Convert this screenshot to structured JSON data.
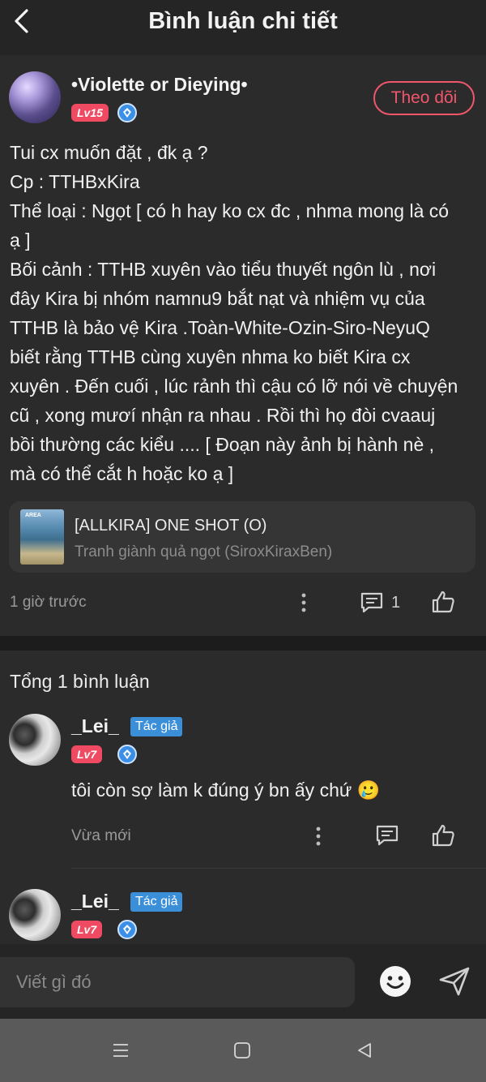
{
  "header": {
    "title": "Bình luận chi tiết"
  },
  "post": {
    "author_name": "•Violette or Dieying•",
    "author_level": "Lv15",
    "follow_label": "Theo dõi",
    "lines": [
      "Tui cx muốn đặt , đk ạ ?",
      "Cp : TTHBxKira",
      "Thể loại : Ngọt [ có h hay ko cx đc , nhma mong là có",
      "ạ ]",
      "Bối cảnh : TTHB xuyên vào tiểu thuyết ngôn lù , nơi",
      "đây Kira bị nhóm namnu9 bắt nạt và nhiệm vụ của",
      "TTHB là bảo vệ Kira .Toàn-White-Ozin-Siro-NeyuQ",
      "biết rằng TTHB cùng xuyên nhma ko biết Kira cx",
      "xuyên . Đến cuối , lúc rảnh thì cậu có lỡ nói về chuyện",
      "cũ , xong mươí nhận ra nhau . Rồi thì họ đòi cvaauj",
      "bồi thường các kiểu .... [ Đoạn này ảnh bị hành nè ,",
      "mà có thể cắt h hoặc ko ạ ]"
    ],
    "story": {
      "cover_text": "AREA",
      "title": "[ALLKIRA] ONE SHOT (O)",
      "subtitle": "Tranh giành quả ngọt (SiroxKiraxBen)"
    },
    "time": "1 giờ trước",
    "comment_count": "1"
  },
  "comments": {
    "total_label": "Tổng 1 bình luận",
    "items": [
      {
        "name": "_Lei_",
        "tag": "Tác giả",
        "level": "Lv7",
        "text": "tôi còn sợ làm k đúng ý bn ấy chứ 🥲",
        "time": "Vừa mới"
      },
      {
        "name": "_Lei_",
        "tag": "Tác giả",
        "level": "Lv7"
      }
    ]
  },
  "input": {
    "placeholder": "Viết gì đó"
  },
  "icons": {
    "back": "chevron-left-icon",
    "more": "more-vertical-icon",
    "comment": "comment-icon",
    "like": "thumbs-up-icon",
    "emoji": "smiley-icon",
    "send": "send-icon",
    "nav_menu": "recent-apps-icon",
    "nav_home": "home-square-icon",
    "nav_back": "back-triangle-icon"
  },
  "colors": {
    "accent": "#f0566b",
    "level_badge": "#f04a63",
    "author_tag": "#3a8fd8",
    "background": "#252525"
  }
}
